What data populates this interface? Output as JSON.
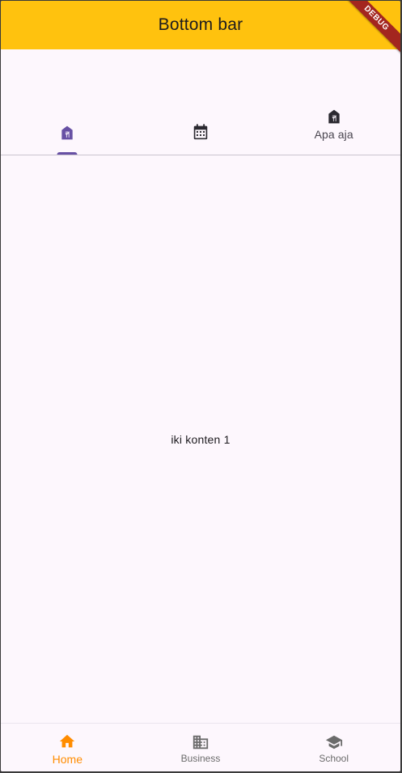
{
  "appbar": {
    "title": "Bottom bar",
    "debug_banner": "DEBUG",
    "color": "#ffc20e"
  },
  "tabs": [
    {
      "icon": "restaurant-building-icon",
      "label": "",
      "selected": true
    },
    {
      "icon": "calendar-icon",
      "label": "",
      "selected": false
    },
    {
      "icon": "restaurant-building-icon",
      "label": "Apa aja",
      "selected": false
    }
  ],
  "content": {
    "text": "iki konten 1"
  },
  "bottom_nav": {
    "items": [
      {
        "icon": "home-icon",
        "label": "Home",
        "active": true
      },
      {
        "icon": "business-icon",
        "label": "Business",
        "active": false
      },
      {
        "icon": "school-icon",
        "label": "School",
        "active": false
      }
    ],
    "active_color": "#ff8c00",
    "inactive_color": "#6b6b6b"
  },
  "colors": {
    "tab_indicator": "#6750a4",
    "background": "#fdf7fd"
  }
}
